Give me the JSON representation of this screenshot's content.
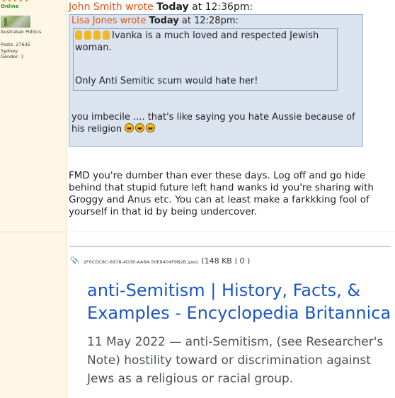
{
  "user": {
    "stars": "★★★★★",
    "status": "Online",
    "group": "Australian Politics",
    "posts": "Posts: 27635",
    "location": "Sydney",
    "gender_label": "Gender: ",
    "gender_symbol": "♀"
  },
  "quote_outer": {
    "author": "John Smith wrote",
    "day": "Today",
    "time": "at 12:36pm:"
  },
  "quote_inner": {
    "author": "Lisa Jones wrote",
    "day": "Today",
    "time": "at 12:28pm:",
    "line1": "Ivanka is a much loved and respected Jewish woman.",
    "line2": "Only Anti Semitic scum would hate her!"
  },
  "quote_reply": "you imbecile ....  that's like saying you hate Aussie because of his religion",
  "post_body": "FMD you're dumber than ever these days. Log off and go hide behind that stupid future left hand wanks id you're sharing with Groggy and Anus etc. You can at least make a farkkking fool of yourself in that id by being undercover.",
  "attachment": {
    "filename": "2F0CDC8C-6978-4D3E-AA6A-50E8404F9B2B.jpeg",
    "size": "(148 KB | 0 )"
  },
  "preview": {
    "title": "anti-Semitism | History, Facts, & Examples - Encyclopedia Britannica",
    "snippet": "11 May 2022 — anti-Semitism, (see Researcher's Note) hostility toward or discrimination against Jews as a religious or racial group."
  },
  "colors": {
    "author_link": "#e05010",
    "quote_bg": "#dbe3ef",
    "sidebar_bg": "#fff7e6",
    "preview_title": "#1a56c4"
  }
}
